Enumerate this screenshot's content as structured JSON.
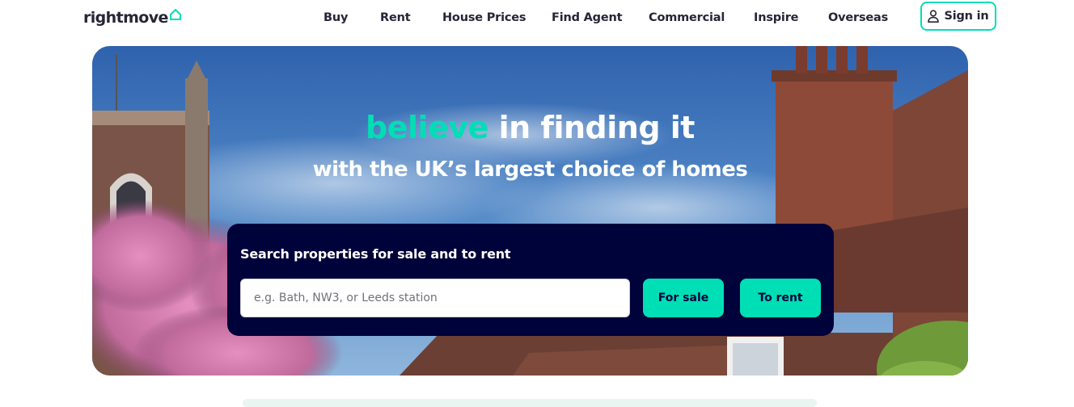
{
  "header": {
    "logo_text": "rightmove",
    "nav": [
      {
        "label": "Buy"
      },
      {
        "label": "Rent"
      },
      {
        "label": "House Prices"
      },
      {
        "label": "Find Agent"
      },
      {
        "label": "Commercial"
      },
      {
        "label": "Inspire"
      },
      {
        "label": "Overseas"
      }
    ],
    "signin_label": "Sign in",
    "signin_icon": "user-icon",
    "logo_icon": "house-icon"
  },
  "hero": {
    "headline_accent": "believe",
    "headline_rest": " in finding it",
    "subheadline": "with the UK’s largest choice of homes"
  },
  "search": {
    "title": "Search properties for sale and to rent",
    "placeholder": "e.g. Bath, NW3, or Leeds station",
    "value": "",
    "for_sale_label": "For sale",
    "to_rent_label": "To rent"
  },
  "colors": {
    "brand_accent": "#00deb6",
    "brand_dark": "#00023a",
    "text": "#262637"
  }
}
